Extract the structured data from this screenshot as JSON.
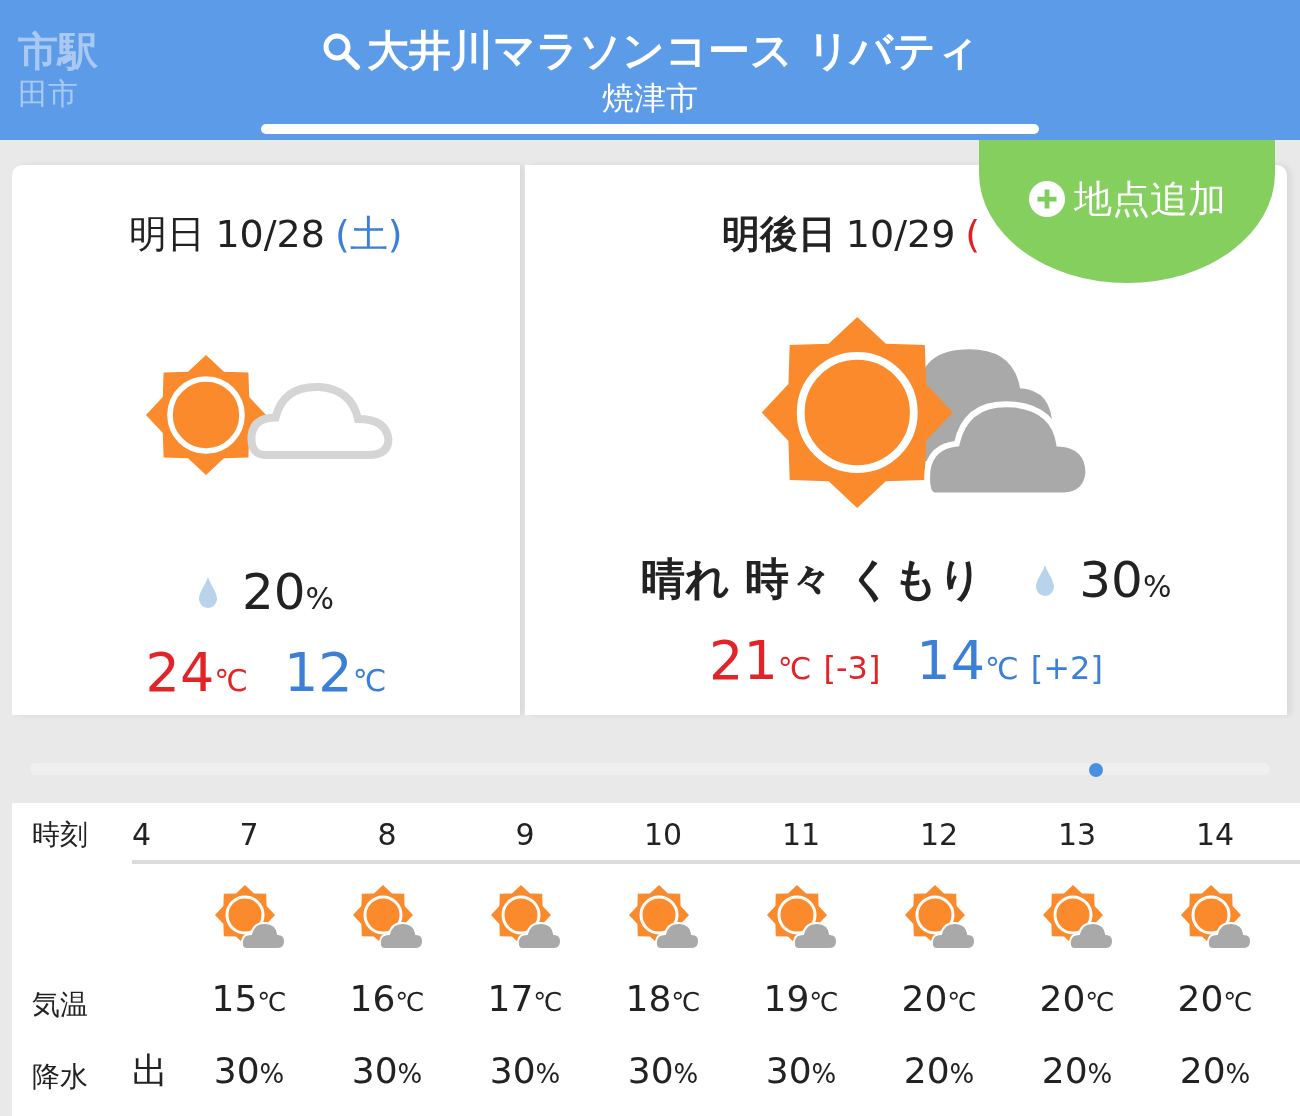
{
  "header": {
    "title": "大井川マラソンコース リバティ",
    "subtitle": "焼津市",
    "prev_location": {
      "name": "市駅",
      "city": "田市"
    }
  },
  "add_button": {
    "label": "地点追加"
  },
  "days": [
    {
      "label": "明日",
      "label_bold": false,
      "date": "10/28",
      "day": "(土)",
      "color": "#3b7fd9",
      "kind": "light",
      "precip": {
        "value": "20",
        "unit": "%"
      },
      "high": {
        "value": "24",
        "unit": "℃"
      },
      "low": {
        "value": "12",
        "unit": "℃"
      }
    },
    {
      "label": "明後日",
      "label_bold": true,
      "date": "10/29",
      "day": "(",
      "color": "#e02020",
      "weather": "晴れ 時々 くもり",
      "kind": "dark",
      "precip": {
        "value": "30",
        "unit": "%"
      },
      "high": {
        "value": "21",
        "unit": "℃",
        "diff": "[-3]"
      },
      "low": {
        "value": "14",
        "unit": "℃",
        "diff": "[+2]"
      }
    }
  ],
  "scroller": {
    "level": 0.86
  },
  "hourly": {
    "row_labels": [
      "時刻",
      "気温",
      "降水"
    ],
    "partial_column": {
      "hour": "4",
      "precip": "出"
    },
    "columns": [
      {
        "hour": "7",
        "temp": "15",
        "unit": "℃",
        "precip": "30",
        "precip_unit": "%"
      },
      {
        "hour": "8",
        "temp": "16",
        "unit": "℃",
        "precip": "30",
        "precip_unit": "%"
      },
      {
        "hour": "9",
        "temp": "17",
        "unit": "℃",
        "precip": "30",
        "precip_unit": "%"
      },
      {
        "hour": "10",
        "temp": "18",
        "unit": "℃",
        "precip": "30",
        "precip_unit": "%"
      },
      {
        "hour": "11",
        "temp": "19",
        "unit": "℃",
        "precip": "30",
        "precip_unit": "%"
      },
      {
        "hour": "12",
        "temp": "20",
        "unit": "℃",
        "precip": "20",
        "precip_unit": "%"
      },
      {
        "hour": "13",
        "temp": "20",
        "unit": "℃",
        "precip": "20",
        "precip_unit": "%"
      },
      {
        "hour": "14",
        "temp": "20",
        "unit": "℃",
        "precip": "20",
        "precip_unit": "%"
      }
    ]
  }
}
